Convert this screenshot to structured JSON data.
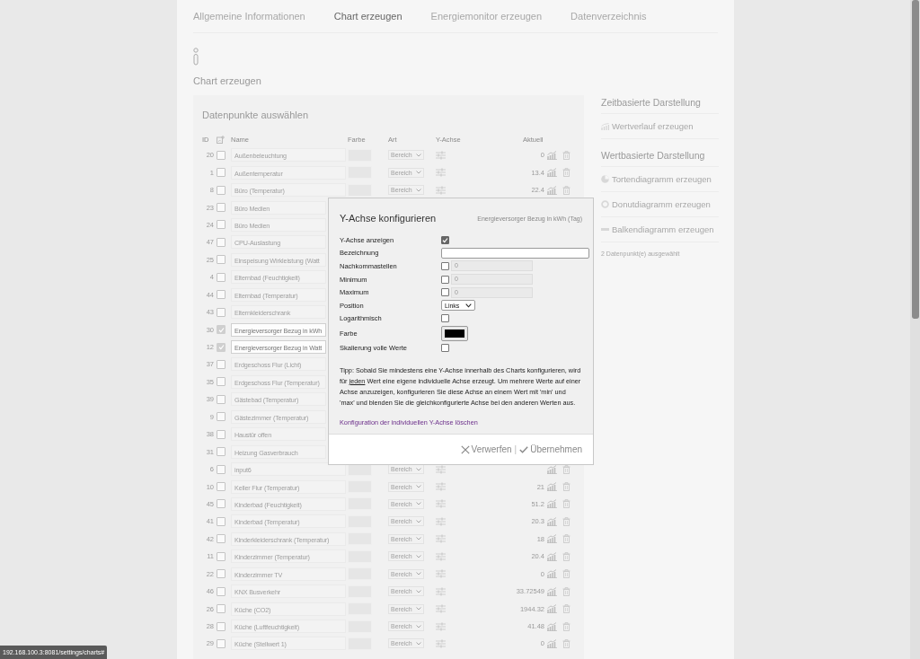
{
  "tabs": [
    {
      "label": "Allgemeine Informationen",
      "selected": false
    },
    {
      "label": "Chart erzeugen",
      "selected": true
    },
    {
      "label": "Energiemonitor erzeugen",
      "selected": false
    },
    {
      "label": "Datenverzeichnis",
      "selected": false
    }
  ],
  "page_title": "Chart erzeugen",
  "panel": {
    "title": "Datenpunkte auswählen",
    "columns": {
      "id": "ID",
      "name": "Name",
      "farbe": "Farbe",
      "art": "Art",
      "y_achse": "Y-Achse",
      "aktuell": "Aktuell"
    },
    "rows": [
      {
        "id": "20",
        "name": "Außenbeleuchtung",
        "checked": false,
        "art": "Bereich",
        "aktuell": "0"
      },
      {
        "id": "1",
        "name": "Außentemperatur",
        "checked": false,
        "art": "Bereich",
        "aktuell": "13.4"
      },
      {
        "id": "8",
        "name": "Büro (Temperatur)",
        "checked": false,
        "art": "Bereich",
        "aktuell": "22.4"
      },
      {
        "id": "23",
        "name": "Büro Medien",
        "checked": false
      },
      {
        "id": "24",
        "name": "Büro Medien",
        "checked": false
      },
      {
        "id": "47",
        "name": "CPU-Auslastung",
        "checked": false
      },
      {
        "id": "25",
        "name": "Einspeisung Wirkleistung (Watt",
        "checked": false
      },
      {
        "id": "4",
        "name": "Elternbad (Feuchtigkeit)",
        "checked": false
      },
      {
        "id": "44",
        "name": "Elternbad (Temperatur)",
        "checked": false
      },
      {
        "id": "43",
        "name": "Elternkleiderschrank",
        "checked": false
      },
      {
        "id": "30",
        "name": "Energieversorger Bezug in kWh",
        "checked": true
      },
      {
        "id": "12",
        "name": "Energieversorger Bezug in Watt",
        "checked": true
      },
      {
        "id": "37",
        "name": "Erdgeschoss Flur (Licht)",
        "checked": false
      },
      {
        "id": "35",
        "name": "Erdgeschoss Flur (Temperatur)",
        "checked": false
      },
      {
        "id": "39",
        "name": "Gästebad (Temperatur)",
        "checked": false
      },
      {
        "id": "9",
        "name": "Gästezimmer (Temperatur)",
        "checked": false
      },
      {
        "id": "38",
        "name": "Haustür offen",
        "checked": false
      },
      {
        "id": "31",
        "name": "Heizung Gasverbrauch",
        "checked": false
      },
      {
        "id": "6",
        "name": "input6",
        "checked": false,
        "art": "Bereich"
      },
      {
        "id": "10",
        "name": "Keller Flur (Temperatur)",
        "checked": false,
        "art": "Bereich",
        "aktuell": "21"
      },
      {
        "id": "45",
        "name": "Kinderbad (Feuchtigkeit)",
        "checked": false,
        "art": "Bereich",
        "aktuell": "51.2"
      },
      {
        "id": "41",
        "name": "Kinderbad (Temperatur)",
        "checked": false,
        "art": "Bereich",
        "aktuell": "20.3"
      },
      {
        "id": "42",
        "name": "Kinderkleiderschrank (Temperatur)",
        "checked": false,
        "art": "Bereich",
        "aktuell": "18"
      },
      {
        "id": "11",
        "name": "Kinderzimmer (Temperatur)",
        "checked": false,
        "art": "Bereich",
        "aktuell": "20.4"
      },
      {
        "id": "22",
        "name": "Kinderzimmer TV",
        "checked": false,
        "art": "Bereich",
        "aktuell": "0"
      },
      {
        "id": "46",
        "name": "KNX Busverkehr",
        "checked": false,
        "art": "Bereich",
        "aktuell": "33.72549"
      },
      {
        "id": "26",
        "name": "Küche (CO2)",
        "checked": false,
        "art": "Bereich",
        "aktuell": "1944.32"
      },
      {
        "id": "28",
        "name": "Küche (Luftfeuchtigkeit)",
        "checked": false,
        "art": "Bereich",
        "aktuell": "41.48"
      },
      {
        "id": "29",
        "name": "Küche (Stellwert 1)",
        "checked": false,
        "art": "Bereich",
        "aktuell": "0"
      }
    ]
  },
  "sidebar": {
    "sections": [
      {
        "title": "Zeitbasierte Darstellung",
        "items": [
          {
            "label": "Wertverlauf erzeugen",
            "kind": "line"
          }
        ]
      },
      {
        "title": "Wertbasierte Darstellung",
        "items": [
          {
            "label": "Tortendiagramm erzeugen",
            "kind": "pie"
          },
          {
            "label": "Donutdiagramm erzeugen",
            "kind": "donut"
          },
          {
            "label": "Balkendiagramm erzeugen",
            "kind": "bar"
          }
        ]
      }
    ],
    "note": "2 Datenpunkt(e) ausgewählt"
  },
  "dialog": {
    "title": "Y-Achse konfigurieren",
    "subtitle": "Energieversorger Bezug in kWh (Tag)",
    "fields": [
      {
        "label": "Y-Achse anzeigen",
        "kind": "checkbox",
        "checked": true
      },
      {
        "label": "Bezeichnung",
        "kind": "text"
      },
      {
        "label": "Nachkommastellen",
        "kind": "number",
        "checked": false,
        "placeholder": "0"
      },
      {
        "label": "Minimum",
        "kind": "number",
        "checked": false,
        "placeholder": "0"
      },
      {
        "label": "Maximum",
        "kind": "number",
        "checked": false,
        "placeholder": "0"
      },
      {
        "label": "Position",
        "kind": "select",
        "value": "Links"
      },
      {
        "label": "Logarithmisch",
        "kind": "checkbox",
        "checked": false
      },
      {
        "label": "Farbe",
        "kind": "color",
        "color": "#000000"
      },
      {
        "label": "Skalierung volle Werte",
        "kind": "checkbox",
        "checked": false
      }
    ],
    "tip_before": "Tipp: Sobald Sie mindestens eine Y-Achse innerhalb des Charts konfigurieren, wird für",
    "tip_link": "jeden",
    "tip_after": "Wert eine eigene individuelle Achse erzeugt. Um mehrere Werte auf einer Achse anzuzeigen, konfigurieren Sie diese Achse an einem Wert mit 'min' und 'max' und blenden Sie die gleichkonfigurierte Achse bei den anderen Werten aus.",
    "reset_link": "Konfiguration der individuellen Y-Achse löschen",
    "discard": "Verwerfen",
    "separator": "|",
    "apply": "Übernehmen"
  },
  "status_url": "192.168.100.3:8081/settings/charts#"
}
